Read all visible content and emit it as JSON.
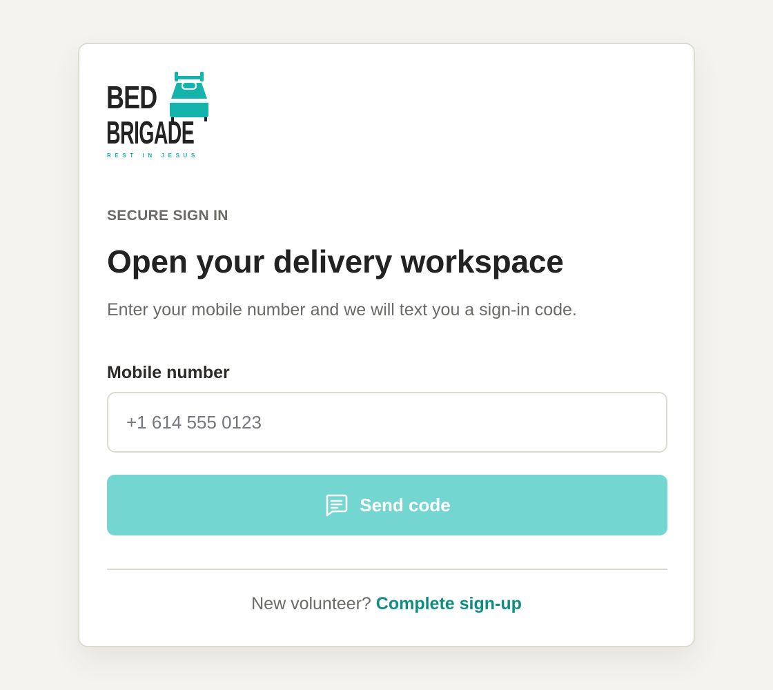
{
  "logo": {
    "word_top": "BED",
    "word_bottom": "BRIGADE",
    "tagline": "REST IN JESUS",
    "icon": "bed-icon"
  },
  "header": {
    "eyebrow": "SECURE SIGN IN",
    "title": "Open your delivery workspace",
    "subtitle": "Enter your mobile number and we will text you a sign-in code."
  },
  "form": {
    "mobile_label": "Mobile number",
    "mobile_placeholder": "+1 614 555 0123",
    "mobile_value": "",
    "send_button_label": "Send code",
    "send_button_icon": "message-square-icon"
  },
  "footer": {
    "prompt": "New volunteer?",
    "link_label": "Complete sign-up"
  },
  "colors": {
    "page_background": "#f4f3ef",
    "card_background": "#ffffff",
    "brand_teal": "#14b3ab",
    "button_teal": "#74d6d0",
    "link_teal": "#0f8c84",
    "text_dark": "#222222",
    "text_muted": "#6b6a66"
  }
}
